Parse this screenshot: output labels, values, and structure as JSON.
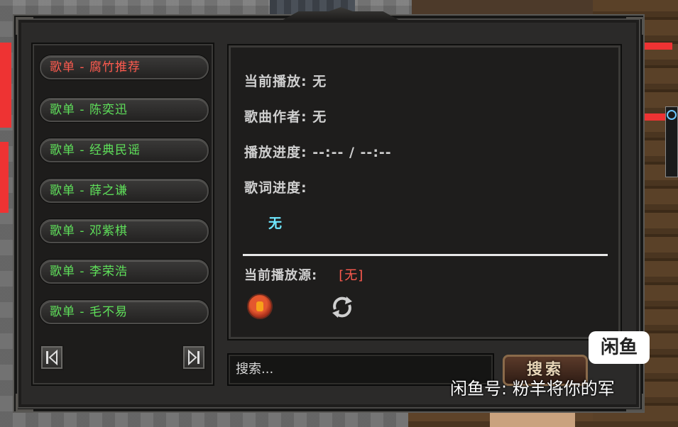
{
  "playlists": [
    {
      "label": "歌单 - 腐竹推荐",
      "active": true
    },
    {
      "label": "歌单 - 陈奕迅",
      "active": false
    },
    {
      "label": "歌单 - 经典民谣",
      "active": false
    },
    {
      "label": "歌单 - 薛之谦",
      "active": false
    },
    {
      "label": "歌单 - 邓紫棋",
      "active": false
    },
    {
      "label": "歌单 - 李荣浩",
      "active": false
    },
    {
      "label": "歌单 - 毛不易",
      "active": false
    }
  ],
  "nav": {
    "prev_icon": "skip-previous-icon",
    "next_icon": "skip-next-icon"
  },
  "info": {
    "now_playing_label": "当前播放:",
    "now_playing_value": "无",
    "artist_label": "歌曲作者:",
    "artist_value": "无",
    "progress_label": "播放进度:",
    "progress_value": "--:-- / --:--",
    "lyrics_label": "歌词进度:",
    "lyrics_value": "无",
    "source_label": "当前播放源:",
    "source_value": "[无]"
  },
  "controls": {
    "stop_icon": "stop-icon",
    "loop_icon": "loop-icon"
  },
  "search": {
    "placeholder": "搜索...",
    "button_label": "搜索"
  },
  "watermark": {
    "badge": "闲鱼",
    "text": "闲鱼号: 粉羊将你的军"
  },
  "colors": {
    "active": "#ff5b4f",
    "normal": "#5fe05a",
    "lyrics": "#6fe8ff"
  }
}
